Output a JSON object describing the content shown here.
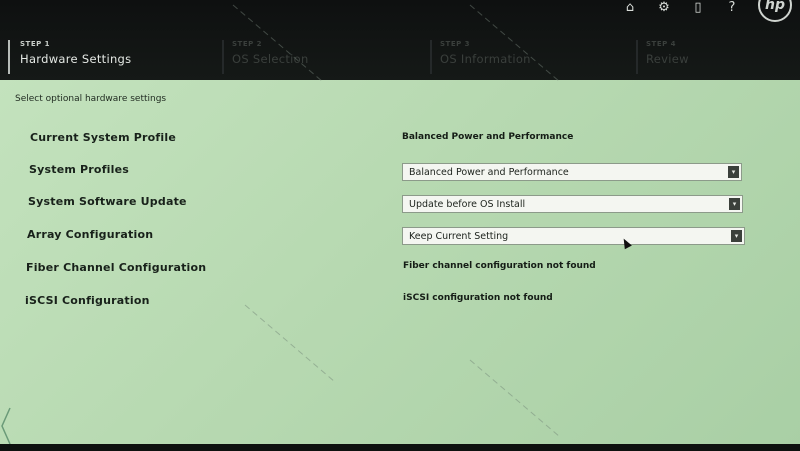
{
  "header": {
    "steps": [
      {
        "num": "STEP 1",
        "title": "Hardware Settings",
        "active": true
      },
      {
        "num": "STEP 2",
        "title": "OS Selection",
        "active": false
      },
      {
        "num": "STEP 3",
        "title": "OS Information",
        "active": false
      },
      {
        "num": "STEP 4",
        "title": "Review",
        "active": false
      }
    ],
    "icons": [
      "home-icon",
      "gear-icon",
      "clipboard-icon",
      "help-icon"
    ],
    "logo": "hp"
  },
  "main": {
    "subtitle": "Select optional hardware settings",
    "rows": [
      {
        "label": "Current System Profile",
        "type": "text",
        "value": "Balanced Power and Performance"
      },
      {
        "label": "System Profiles",
        "type": "select",
        "value": "Balanced Power and Performance"
      },
      {
        "label": "System Software Update",
        "type": "select",
        "value": "Update before OS Install"
      },
      {
        "label": "Array Configuration",
        "type": "select",
        "value": "Keep Current Setting"
      },
      {
        "label": "Fiber Channel Configuration",
        "type": "text",
        "value": "Fiber channel configuration not found"
      },
      {
        "label": "iSCSI Configuration",
        "type": "text",
        "value": "iSCSI configuration not found"
      }
    ]
  },
  "colors": {
    "panel_bg": "#bcdcb6",
    "header_bg": "#111413",
    "text": "#18211a"
  }
}
